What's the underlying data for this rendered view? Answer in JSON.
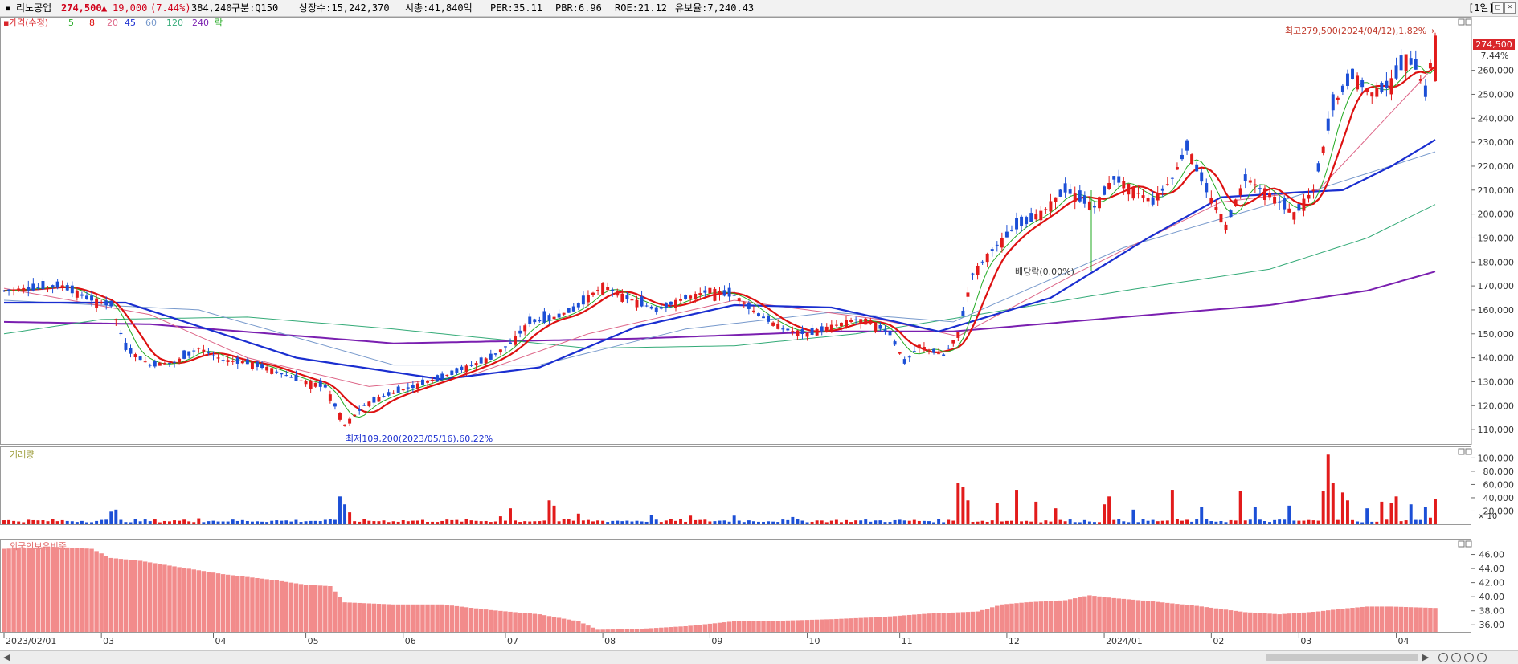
{
  "header": {
    "stock_name": "리노공업",
    "price": "274,500",
    "change_arrow": "▲",
    "change": "19,000",
    "change_pct": "(7.44%)",
    "volume": "384,240",
    "market_code": "구분:Q150",
    "listed_shares": "상장수:15,242,370",
    "market_cap": "시총:41,840억",
    "per": "PER:35.11",
    "pbr": "PBR:6.96",
    "roe": "ROE:21.12",
    "retention": "유보율:7,240.43",
    "period_button": "[1일]"
  },
  "legend": {
    "price_label": "가격(수정)",
    "ma_labels": [
      "5",
      "8",
      "20",
      "45",
      "60",
      "120",
      "240"
    ],
    "extra_label": "락",
    "volume_label": "거래량",
    "foreign_label": "외국인보유비중"
  },
  "colors": {
    "up": "#e21b1b",
    "down": "#1c4fd6",
    "ma5": "#22aa22",
    "ma8": "#dd1111",
    "ma20": "#dd6688",
    "ma45": "#1a2ed0",
    "ma60": "#7799cc",
    "ma120": "#33aa77",
    "ma240": "#7a1fb0",
    "foreign_bar": "#f28b8b",
    "label_box": "#d9262b"
  },
  "annotations": {
    "high_label": "최고279,500(2024/04/12),1.82%",
    "low_label": "최저109,200(2023/05/16),60.22%",
    "dividend_label": "배당락(0.00%)",
    "last_price_box": "274,500",
    "last_pct": "7.44%",
    "volume_unit": "× 10"
  },
  "chart_data": [
    {
      "type": "candlestick",
      "title": "가격(수정)",
      "x_ticks": [
        "2023/02/01",
        "03",
        "04",
        "05",
        "06",
        "07",
        "08",
        "09",
        "10",
        "11",
        "12",
        "2024/01",
        "02",
        "03",
        "04"
      ],
      "y_ticks": [
        "110,000",
        "120,000",
        "130,000",
        "140,000",
        "150,000",
        "160,000",
        "170,000",
        "180,000",
        "190,000",
        "200,000",
        "210,000",
        "220,000",
        "230,000",
        "240,000",
        "250,000",
        "260,000"
      ],
      "ylim": [
        104000,
        282000
      ],
      "sessions": 295,
      "month_start_index": [
        0,
        20,
        43,
        62,
        82,
        103,
        123,
        145,
        165,
        184,
        206,
        226,
        248,
        266,
        286
      ],
      "close_path": [
        [
          0,
          168000
        ],
        [
          12,
          170000
        ],
        [
          17,
          165000
        ],
        [
          22,
          162000
        ],
        [
          25,
          144000
        ],
        [
          30,
          137000
        ],
        [
          35,
          138000
        ],
        [
          40,
          144000
        ],
        [
          45,
          139000
        ],
        [
          50,
          138000
        ],
        [
          55,
          135000
        ],
        [
          60,
          131000
        ],
        [
          66,
          128000
        ],
        [
          70,
          112000
        ],
        [
          74,
          120000
        ],
        [
          78,
          124000
        ],
        [
          84,
          128000
        ],
        [
          90,
          132000
        ],
        [
          95,
          136000
        ],
        [
          100,
          140000
        ],
        [
          104,
          146000
        ],
        [
          108,
          155000
        ],
        [
          112,
          156000
        ],
        [
          117,
          160000
        ],
        [
          123,
          170000
        ],
        [
          128,
          165000
        ],
        [
          134,
          160000
        ],
        [
          140,
          165000
        ],
        [
          145,
          168000
        ],
        [
          150,
          166000
        ],
        [
          155,
          158000
        ],
        [
          160,
          152000
        ],
        [
          165,
          150000
        ],
        [
          170,
          153000
        ],
        [
          175,
          156000
        ],
        [
          178,
          155000
        ],
        [
          182,
          150000
        ],
        [
          185,
          138000
        ],
        [
          188,
          145000
        ],
        [
          193,
          141000
        ],
        [
          196,
          150000
        ],
        [
          199,
          175000
        ],
        [
          203,
          185000
        ],
        [
          208,
          195000
        ],
        [
          213,
          200000
        ],
        [
          218,
          210000
        ],
        [
          224,
          203000
        ],
        [
          228,
          215000
        ],
        [
          232,
          210000
        ],
        [
          236,
          205000
        ],
        [
          240,
          215000
        ],
        [
          243,
          228000
        ],
        [
          247,
          210000
        ],
        [
          251,
          195000
        ],
        [
          255,
          215000
        ],
        [
          260,
          208000
        ],
        [
          265,
          200000
        ],
        [
          269,
          210000
        ],
        [
          273,
          245000
        ],
        [
          277,
          258000
        ],
        [
          281,
          250000
        ],
        [
          285,
          255000
        ],
        [
          288,
          265000
        ],
        [
          290,
          262000
        ],
        [
          292,
          250000
        ],
        [
          294,
          274500
        ]
      ],
      "ma20_path": [
        [
          0,
          169000
        ],
        [
          30,
          158000
        ],
        [
          50,
          140000
        ],
        [
          75,
          128000
        ],
        [
          95,
          132000
        ],
        [
          120,
          150000
        ],
        [
          150,
          164000
        ],
        [
          180,
          156000
        ],
        [
          196,
          149000
        ],
        [
          220,
          175000
        ],
        [
          250,
          205000
        ],
        [
          270,
          210000
        ],
        [
          294,
          262000
        ]
      ],
      "ma45_path": [
        [
          0,
          163000
        ],
        [
          25,
          163000
        ],
        [
          60,
          140000
        ],
        [
          90,
          131000
        ],
        [
          110,
          136000
        ],
        [
          130,
          153000
        ],
        [
          150,
          162000
        ],
        [
          170,
          161000
        ],
        [
          192,
          151000
        ],
        [
          215,
          165000
        ],
        [
          235,
          190000
        ],
        [
          250,
          207000
        ],
        [
          265,
          209000
        ],
        [
          275,
          210000
        ],
        [
          285,
          220000
        ],
        [
          294,
          231000
        ]
      ],
      "ma60_path": [
        [
          0,
          164000
        ],
        [
          40,
          160000
        ],
        [
          80,
          137000
        ],
        [
          110,
          137000
        ],
        [
          140,
          152000
        ],
        [
          170,
          159000
        ],
        [
          195,
          155000
        ],
        [
          230,
          186000
        ],
        [
          260,
          204000
        ],
        [
          294,
          226000
        ]
      ],
      "ma120_path": [
        [
          0,
          150000
        ],
        [
          20,
          156000
        ],
        [
          50,
          157000
        ],
        [
          80,
          152000
        ],
        [
          120,
          144000
        ],
        [
          150,
          145000
        ],
        [
          175,
          150000
        ],
        [
          200,
          158000
        ],
        [
          230,
          168000
        ],
        [
          260,
          177000
        ],
        [
          280,
          190000
        ],
        [
          294,
          204000
        ]
      ],
      "ma240_path": [
        [
          0,
          155000
        ],
        [
          30,
          154000
        ],
        [
          80,
          146000
        ],
        [
          130,
          148000
        ],
        [
          170,
          151000
        ],
        [
          195,
          151000
        ],
        [
          230,
          157000
        ],
        [
          260,
          162000
        ],
        [
          280,
          168000
        ],
        [
          294,
          176000
        ]
      ],
      "high": {
        "date": "2024/04/12",
        "value": 279500,
        "pct": 1.82
      },
      "low": {
        "date": "2023/05/16",
        "value": 109200,
        "pct": 60.22
      },
      "last": {
        "value": 274500,
        "pct": 7.44
      }
    },
    {
      "type": "bar",
      "title": "거래량",
      "y_ticks": [
        "20,000",
        "40,000",
        "60,000",
        "80,000",
        "100,000"
      ],
      "ylim": [
        0,
        115000
      ],
      "unit": "× 10",
      "baseline": 5000,
      "spikes": [
        [
          22,
          19000
        ],
        [
          23,
          22000
        ],
        [
          40,
          9000
        ],
        [
          69,
          42000
        ],
        [
          70,
          30000
        ],
        [
          71,
          18000
        ],
        [
          102,
          12000
        ],
        [
          104,
          24000
        ],
        [
          112,
          36000
        ],
        [
          113,
          28000
        ],
        [
          118,
          16000
        ],
        [
          133,
          14000
        ],
        [
          141,
          13000
        ],
        [
          150,
          13000
        ],
        [
          162,
          11000
        ],
        [
          196,
          62000
        ],
        [
          197,
          56000
        ],
        [
          198,
          36000
        ],
        [
          204,
          32000
        ],
        [
          208,
          52000
        ],
        [
          212,
          34000
        ],
        [
          216,
          24000
        ],
        [
          226,
          30000
        ],
        [
          227,
          42000
        ],
        [
          232,
          22000
        ],
        [
          240,
          52000
        ],
        [
          246,
          26000
        ],
        [
          254,
          50000
        ],
        [
          257,
          26000
        ],
        [
          264,
          28000
        ],
        [
          271,
          50000
        ],
        [
          272,
          105000
        ],
        [
          273,
          62000
        ],
        [
          275,
          48000
        ],
        [
          276,
          36000
        ],
        [
          280,
          24000
        ],
        [
          283,
          34000
        ],
        [
          285,
          32000
        ],
        [
          286,
          42000
        ],
        [
          289,
          30000
        ],
        [
          292,
          26000
        ],
        [
          293,
          10000
        ],
        [
          294,
          38000
        ]
      ]
    },
    {
      "type": "bar",
      "title": "외국인보유비중",
      "y_ticks": [
        "36.00",
        "38.00",
        "40.00",
        "42.00",
        "44.00",
        "46.00"
      ],
      "ylim": [
        35,
        48
      ],
      "path": [
        [
          0,
          46.8
        ],
        [
          10,
          47.1
        ],
        [
          18,
          46.8
        ],
        [
          22,
          45.5
        ],
        [
          28,
          45.1
        ],
        [
          35,
          44.3
        ],
        [
          45,
          43.2
        ],
        [
          55,
          42.4
        ],
        [
          62,
          41.7
        ],
        [
          67,
          41.5
        ],
        [
          70,
          39.2
        ],
        [
          80,
          38.9
        ],
        [
          90,
          38.9
        ],
        [
          100,
          38.1
        ],
        [
          110,
          37.5
        ],
        [
          118,
          36.5
        ],
        [
          122,
          35.3
        ],
        [
          130,
          35.4
        ],
        [
          140,
          35.8
        ],
        [
          150,
          36.5
        ],
        [
          160,
          36.6
        ],
        [
          170,
          36.8
        ],
        [
          180,
          37.1
        ],
        [
          190,
          37.6
        ],
        [
          200,
          37.9
        ],
        [
          205,
          38.9
        ],
        [
          210,
          39.2
        ],
        [
          218,
          39.5
        ],
        [
          223,
          40.2
        ],
        [
          228,
          39.8
        ],
        [
          235,
          39.4
        ],
        [
          245,
          38.7
        ],
        [
          255,
          37.8
        ],
        [
          262,
          37.5
        ],
        [
          270,
          37.9
        ],
        [
          275,
          38.3
        ],
        [
          280,
          38.6
        ],
        [
          285,
          38.6
        ],
        [
          294,
          38.4
        ]
      ]
    }
  ]
}
